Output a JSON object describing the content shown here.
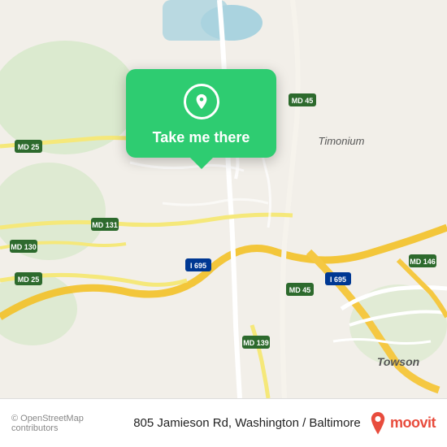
{
  "map": {
    "alt": "Map of 805 Jamieson Rd area, Washington / Baltimore"
  },
  "popup": {
    "label": "Take me there",
    "icon": "location-pin-icon"
  },
  "bottom_bar": {
    "copyright": "© OpenStreetMap contributors",
    "address": "805 Jamieson Rd, Washington / Baltimore",
    "moovit_label": "moovit"
  },
  "colors": {
    "popup_bg": "#2ecc71",
    "road_yellow": "#f5e87a",
    "road_white": "#ffffff",
    "green_area": "#c8e6c0",
    "water": "#aad3df",
    "land": "#f2efe9",
    "highway": "#f5c842",
    "moovit_red": "#e84c3d"
  }
}
